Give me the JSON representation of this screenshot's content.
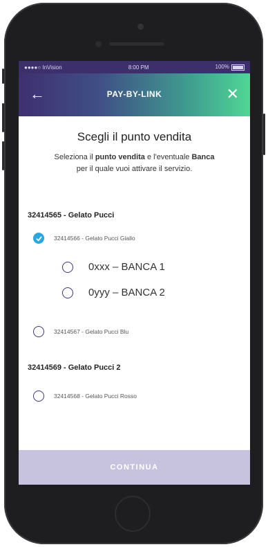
{
  "statusbar": {
    "carrier": "●●●●○ InVision",
    "time": "8:00 PM",
    "battery": "100%"
  },
  "header": {
    "back_icon": "←",
    "title": "PAY-BY-LINK",
    "close_icon": "✕"
  },
  "main": {
    "title": "Scegli il punto vendita",
    "subtitle_parts": [
      "Seleziona il ",
      "punto vendita",
      " e l'eventuale ",
      "Banca",
      "per il quale vuoi attivare il servizio."
    ],
    "groups": [
      {
        "label": "32414565 - Gelato Pucci"
      },
      {
        "label": "32414569 - Gelato Pucci 2"
      }
    ],
    "options": [
      {
        "label": "32414566 - Gelato Pucci Giallo",
        "checked": true
      },
      {
        "label": "0xxx – BANCA 1",
        "checked": false
      },
      {
        "label": "0yyy – BANCA 2",
        "checked": false
      },
      {
        "label": "32414567 - Gelato Pucci Blu",
        "checked": false
      },
      {
        "label": "32414568 - Gelato Pucci Rosso",
        "checked": false
      }
    ]
  },
  "footer": {
    "button_label": "CONTINUA"
  },
  "colors": {
    "accent_check": "#2aa6e0",
    "radio_border": "#3e3280",
    "button_disabled": "#c7c3de"
  }
}
